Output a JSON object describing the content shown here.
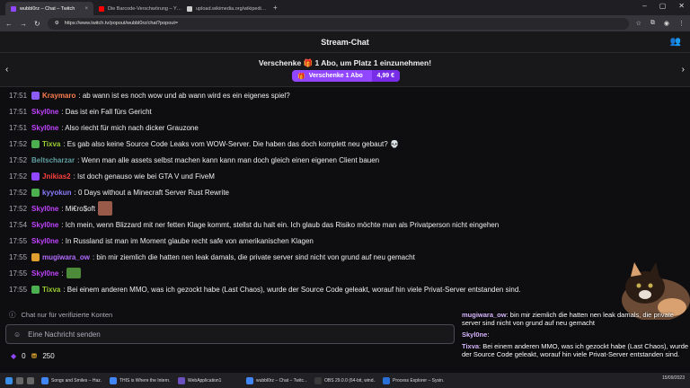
{
  "browser": {
    "tabs": [
      {
        "title": "wubbl0rz – Chat – Twitch",
        "active": true,
        "color": "#9147ff"
      },
      {
        "title": "Die Barcode-Verschwörung – Y…",
        "active": false,
        "color": "#ff0000"
      },
      {
        "title": "upload.wikimedia.org/wikipedi…",
        "active": false,
        "color": "#cccccc"
      }
    ],
    "url": "https://www.twitch.tv/popout/wubbl0rz/chat?popout="
  },
  "header": {
    "title": "Stream-Chat"
  },
  "gift": {
    "title": "Verschenke 🎁 1 Abo, um Platz 1 einzunehmen!",
    "button_label": "Verschenke 1 Abo",
    "price": "4,99 €"
  },
  "messages": [
    {
      "ts": "17:51",
      "user": "Kraymaro",
      "color": "#ff7f50",
      "badge": "#8b5cf6",
      "text": ": ab wann ist es noch wow und ab wann wird es ein eigenes spiel?"
    },
    {
      "ts": "17:51",
      "user": "Skyl0ne",
      "color": "#c043ff",
      "badge": "",
      "text": ": Das ist ein Fall fürs Gericht"
    },
    {
      "ts": "17:51",
      "user": "Skyl0ne",
      "color": "#c043ff",
      "badge": "",
      "text": ": Also riecht für mich nach dicker Grauzone"
    },
    {
      "ts": "17:52",
      "user": "Tixva",
      "color": "#9acd32",
      "badge": "#4caf50",
      "text": ": Es gab also keine Source Code Leaks vom WOW-Server. Die haben das doch komplett neu gebaut? 💀"
    },
    {
      "ts": "17:52",
      "user": "Beltscharzar",
      "color": "#5f9ea0",
      "badge": "",
      "text": ": Wenn man alle assets selbst machen kann kann man doch gleich einen eigenen Client bauen"
    },
    {
      "ts": "17:52",
      "user": "Jnikias2",
      "color": "#ff4040",
      "badge": "#9147ff",
      "text": ": Ist doch genauso wie bei GTA V und FiveM"
    },
    {
      "ts": "17:52",
      "user": "kyyokun",
      "color": "#8a7dff",
      "badge": "#4caf50",
      "text": ": 0 Days without a Minecraft Server Rust Rewrite"
    },
    {
      "ts": "17:52",
      "user": "Skyl0ne",
      "color": "#c043ff",
      "badge": "",
      "text": ": Mi€ro$oft"
    },
    {
      "ts": "17:54",
      "user": "Skyl0ne",
      "color": "#c043ff",
      "badge": "",
      "text": ": Ich mein, wenn Blizzard mit ner fetten Klage kommt, stellst du halt ein. Ich glaub das Risiko möchte man als Privatperson nicht eingehen"
    },
    {
      "ts": "17:55",
      "user": "Skyl0ne",
      "color": "#c043ff",
      "badge": "",
      "text": ": In Russland ist man im Moment glaube recht safe von amerikanischen Klagen"
    },
    {
      "ts": "17:55",
      "user": "mugiwara_ow",
      "color": "#b36bff",
      "badge": "#e0a030",
      "text": ": bin mir ziemlich die hatten nen leak damals, die private server sind nicht von grund auf neu gemacht"
    },
    {
      "ts": "17:55",
      "user": "Skyl0ne",
      "color": "#c043ff",
      "badge": "",
      "text": ":"
    },
    {
      "ts": "17:55",
      "user": "Tixva",
      "color": "#9acd32",
      "badge": "#4caf50",
      "text": ": Bei einem anderen MMO, was ich gezockt habe (Last Chaos), wurde der Source Code geleakt, worauf hin viele Privat-Server entstanden sind."
    }
  ],
  "footer": {
    "verified_note": "Chat nur für verifizierte Konten",
    "input_placeholder": "Eine Nachricht senden",
    "bits": "0",
    "points": "250"
  },
  "overlay": [
    {
      "user": "mugiwara_ow",
      "text": ": bin mir ziemlich die hatten nen leak damals, die private server sind nicht von grund auf neu gemacht"
    },
    {
      "user": "Skyl0ne",
      "text": ":"
    },
    {
      "user": "Tixva",
      "text": ": Bei einem anderen MMO, was ich gezockt habe (Last Chaos), wurde der Source Code geleakt, worauf hin viele Privat-Server entstanden sind."
    }
  ],
  "taskbar": {
    "items": [
      "Songs and Smiles – Haz…",
      "THIS is Where the Intern…",
      "WebApplication1",
      "wubbl0rz – Chat – Twitc…",
      "OBS 29.0.0 (64-bit, wind…",
      "Process Explorer – Sysin…"
    ],
    "time": "15/09/2023"
  }
}
